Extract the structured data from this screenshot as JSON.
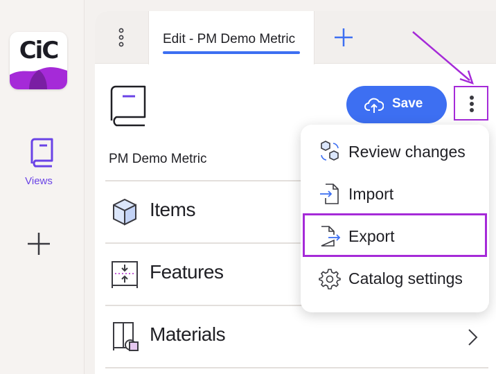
{
  "app": {
    "logo_text": "CiC",
    "brand_color": "#a52ad8"
  },
  "nav": {
    "views_label": "Views",
    "views_icon": "book-icon",
    "add_icon": "plus-icon"
  },
  "tabs": {
    "more_icon": "vertical-ellipsis-icon",
    "active_label": "Edit - PM Demo Metric",
    "add_icon": "plus-icon"
  },
  "toolbar": {
    "save_label": "Save",
    "save_icon": "cloud-upload-icon",
    "more_icon": "vertical-ellipsis-icon",
    "accent": "#3d6ff2"
  },
  "catalog": {
    "name": "PM Demo Metric",
    "sections": [
      {
        "label": "Items",
        "icon": "box-icon"
      },
      {
        "label": "Features",
        "icon": "features-icon"
      },
      {
        "label": "Materials",
        "icon": "materials-icon"
      }
    ]
  },
  "menu": {
    "items": [
      {
        "label": "Review changes",
        "icon": "review-changes-icon"
      },
      {
        "label": "Import",
        "icon": "import-icon"
      },
      {
        "label": "Export",
        "icon": "export-icon"
      },
      {
        "label": "Catalog settings",
        "icon": "gear-icon"
      }
    ]
  }
}
